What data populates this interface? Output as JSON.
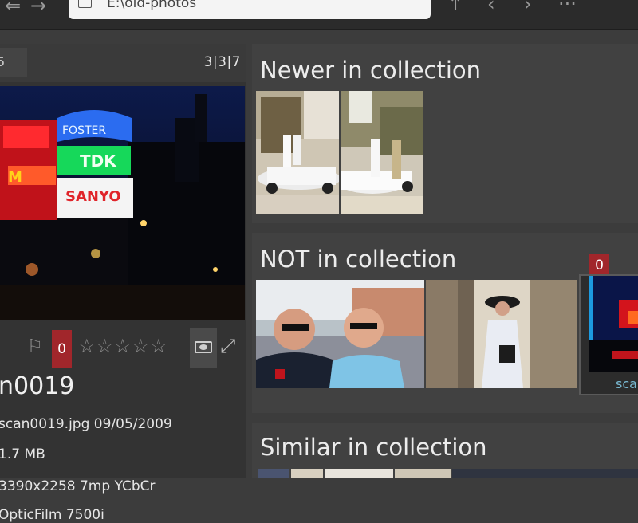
{
  "toolbar": {
    "path": "E:\\old-photos",
    "back_icon": "back-arrow-icon",
    "forward_icon": "forward-arrow-icon"
  },
  "info_panel": {
    "counter": "3|3|7",
    "tab_label": "5",
    "rating_count": "0",
    "stars": "☆☆☆☆☆",
    "filename": "n0019",
    "meta": [
      "scan0019.jpg 09/05/2009",
      "1.7 MB",
      "3390x2258 7mp YCbCr",
      "OpticFilm 7500i"
    ]
  },
  "sections": {
    "newer": {
      "title": "Newer in collection"
    },
    "not_in": {
      "title": "NOT in collection",
      "selected_count": "0",
      "selected_name": "sca"
    },
    "similar": {
      "title": "Similar in collection"
    }
  },
  "colors": {
    "background": "#3c3c3c",
    "badge_red": "#a1262b",
    "selection_blue": "#1c9ae0"
  }
}
